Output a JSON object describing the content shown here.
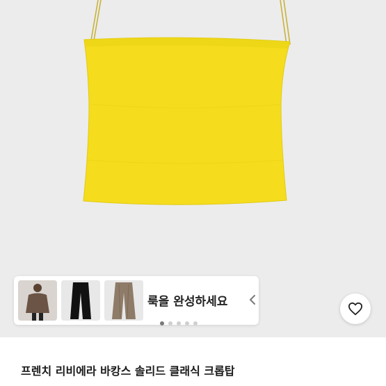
{
  "product": {
    "title": "프렌치 리비에라 바캉스 솔리드 클래식 크롭탑",
    "color": "#f5dd1e"
  },
  "outfit_strip": {
    "text": "룩을 완성하세요",
    "items": [
      "jacket-thumbnail",
      "black-trousers-thumbnail",
      "brown-trousers-thumbnail"
    ]
  },
  "icons": {
    "favorite": "heart-icon",
    "collapse": "chevron-left-icon"
  },
  "gallery": {
    "dot_count": 5,
    "active_index": 0
  }
}
